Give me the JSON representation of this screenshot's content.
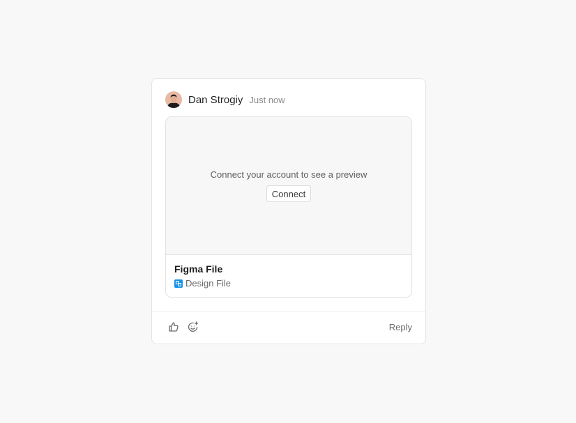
{
  "comment": {
    "author": "Dan Strogiy",
    "timestamp": "Just now",
    "avatar_icon": "user-avatar"
  },
  "embed": {
    "preview_message": "Connect your account to see a preview",
    "connect_label": "Connect",
    "title": "Figma File",
    "type_label": "Design File",
    "type_icon": "design-file-icon",
    "type_icon_color": "#1593e6"
  },
  "actions": {
    "like_icon": "thumbs-up-icon",
    "emoji_icon": "add-reaction-icon",
    "reply_label": "Reply"
  }
}
